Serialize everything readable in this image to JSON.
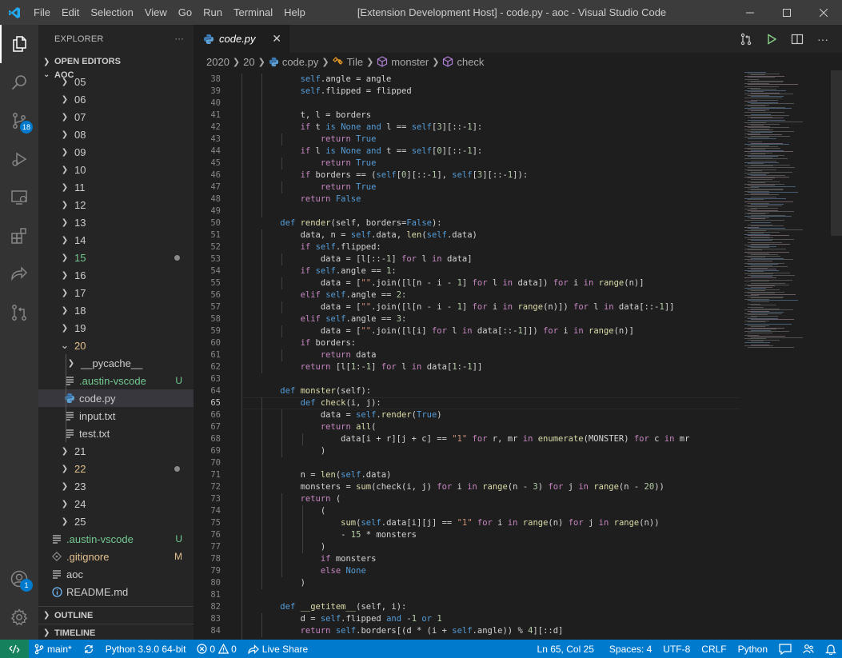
{
  "menu": [
    "File",
    "Edit",
    "Selection",
    "View",
    "Go",
    "Run",
    "Terminal",
    "Help"
  ],
  "window_title": "[Extension Development Host] - code.py - aoc - Visual Studio Code",
  "activity": {
    "scm_badge": "18",
    "accounts_badge": "1"
  },
  "sidebar": {
    "title": "EXPLORER",
    "more": "···",
    "open_editors": "OPEN EDITORS",
    "root": "AOC",
    "outline": "OUTLINE",
    "timeline": "TIMELINE"
  },
  "tree": [
    {
      "label": "05",
      "kind": "folder",
      "depth": 1,
      "open": false
    },
    {
      "label": "06",
      "kind": "folder",
      "depth": 1,
      "open": false
    },
    {
      "label": "07",
      "kind": "folder",
      "depth": 1,
      "open": false
    },
    {
      "label": "08",
      "kind": "folder",
      "depth": 1,
      "open": false
    },
    {
      "label": "09",
      "kind": "folder",
      "depth": 1,
      "open": false
    },
    {
      "label": "10",
      "kind": "folder",
      "depth": 1,
      "open": false
    },
    {
      "label": "11",
      "kind": "folder",
      "depth": 1,
      "open": false
    },
    {
      "label": "12",
      "kind": "folder",
      "depth": 1,
      "open": false
    },
    {
      "label": "13",
      "kind": "folder",
      "depth": 1,
      "open": false
    },
    {
      "label": "14",
      "kind": "folder",
      "depth": 1,
      "open": false
    },
    {
      "label": "15",
      "kind": "folder",
      "depth": 1,
      "open": false,
      "color": "green",
      "dot": true
    },
    {
      "label": "16",
      "kind": "folder",
      "depth": 1,
      "open": false
    },
    {
      "label": "17",
      "kind": "folder",
      "depth": 1,
      "open": false
    },
    {
      "label": "18",
      "kind": "folder",
      "depth": 1,
      "open": false
    },
    {
      "label": "19",
      "kind": "folder",
      "depth": 1,
      "open": false
    },
    {
      "label": "20",
      "kind": "folder",
      "depth": 1,
      "open": true,
      "color": "gold"
    },
    {
      "label": "__pycache__",
      "kind": "folder",
      "depth": 2,
      "open": false
    },
    {
      "label": ".austin-vscode",
      "kind": "file",
      "depth": 2,
      "color": "green",
      "deco": "U",
      "icon": "lines"
    },
    {
      "label": "code.py",
      "kind": "file",
      "depth": 2,
      "selected": true,
      "icon": "python"
    },
    {
      "label": "input.txt",
      "kind": "file",
      "depth": 2,
      "icon": "lines"
    },
    {
      "label": "test.txt",
      "kind": "file",
      "depth": 2,
      "icon": "lines"
    },
    {
      "label": "21",
      "kind": "folder",
      "depth": 1,
      "open": false
    },
    {
      "label": "22",
      "kind": "folder",
      "depth": 1,
      "open": false,
      "color": "gold",
      "dot": true
    },
    {
      "label": "23",
      "kind": "folder",
      "depth": 1,
      "open": false
    },
    {
      "label": "24",
      "kind": "folder",
      "depth": 1,
      "open": false
    },
    {
      "label": "25",
      "kind": "folder",
      "depth": 1,
      "open": false
    },
    {
      "label": ".austin-vscode",
      "kind": "file",
      "depth": 1,
      "color": "green",
      "deco": "U",
      "icon": "lines"
    },
    {
      "label": ".gitignore",
      "kind": "file",
      "depth": 1,
      "color": "gold",
      "deco": "M",
      "icon": "git"
    },
    {
      "label": "aoc",
      "kind": "file",
      "depth": 1,
      "icon": "lines"
    },
    {
      "label": "README.md",
      "kind": "file",
      "depth": 1,
      "icon": "info"
    }
  ],
  "tab": {
    "label": "code.py",
    "close": "✕"
  },
  "breadcrumbs": [
    "2020",
    "20",
    "code.py",
    "Tile",
    "monster",
    "check"
  ],
  "editor": {
    "first_line": 38,
    "current_line": 65
  },
  "code_lines": [
    [
      [
        "        ",
        ""
      ],
      [
        "self",
        "k"
      ],
      [
        ".angle = angle",
        ""
      ]
    ],
    [
      [
        "        ",
        ""
      ],
      [
        "self",
        "k"
      ],
      [
        ".flipped = flipped",
        ""
      ]
    ],
    [
      [
        "",
        ""
      ]
    ],
    [
      [
        "        t, l = borders",
        ""
      ]
    ],
    [
      [
        "        ",
        ""
      ],
      [
        "if",
        "c"
      ],
      [
        " t ",
        ""
      ],
      [
        "is",
        "k"
      ],
      [
        " ",
        ""
      ],
      [
        "None",
        "k"
      ],
      [
        " ",
        ""
      ],
      [
        "and",
        "k"
      ],
      [
        " l == ",
        ""
      ],
      [
        "self",
        "k"
      ],
      [
        "[",
        ""
      ],
      [
        "3",
        "n"
      ],
      [
        "][::-",
        ""
      ],
      [
        "1",
        "n"
      ],
      [
        "]:",
        ""
      ]
    ],
    [
      [
        "            ",
        ""
      ],
      [
        "return",
        "c"
      ],
      [
        " ",
        ""
      ],
      [
        "True",
        "k"
      ]
    ],
    [
      [
        "        ",
        ""
      ],
      [
        "if",
        "c"
      ],
      [
        " l ",
        ""
      ],
      [
        "is",
        "k"
      ],
      [
        " ",
        ""
      ],
      [
        "None",
        "k"
      ],
      [
        " ",
        ""
      ],
      [
        "and",
        "k"
      ],
      [
        " t == ",
        ""
      ],
      [
        "self",
        "k"
      ],
      [
        "[",
        ""
      ],
      [
        "0",
        "n"
      ],
      [
        "][::-",
        ""
      ],
      [
        "1",
        "n"
      ],
      [
        "]:",
        ""
      ]
    ],
    [
      [
        "            ",
        ""
      ],
      [
        "return",
        "c"
      ],
      [
        " ",
        ""
      ],
      [
        "True",
        "k"
      ]
    ],
    [
      [
        "        ",
        ""
      ],
      [
        "if",
        "c"
      ],
      [
        " borders == (",
        ""
      ],
      [
        "self",
        "k"
      ],
      [
        "[",
        ""
      ],
      [
        "0",
        "n"
      ],
      [
        "][::-",
        ""
      ],
      [
        "1",
        "n"
      ],
      [
        "], ",
        ""
      ],
      [
        "self",
        "k"
      ],
      [
        "[",
        ""
      ],
      [
        "3",
        "n"
      ],
      [
        "][::-",
        ""
      ],
      [
        "1",
        "n"
      ],
      [
        "]):",
        ""
      ]
    ],
    [
      [
        "            ",
        ""
      ],
      [
        "return",
        "c"
      ],
      [
        " ",
        ""
      ],
      [
        "True",
        "k"
      ]
    ],
    [
      [
        "        ",
        ""
      ],
      [
        "return",
        "c"
      ],
      [
        " ",
        ""
      ],
      [
        "False",
        "k"
      ]
    ],
    [
      [
        "",
        ""
      ]
    ],
    [
      [
        "    ",
        ""
      ],
      [
        "def",
        "k"
      ],
      [
        " ",
        ""
      ],
      [
        "render",
        "f"
      ],
      [
        "(self, borders=",
        ""
      ],
      [
        "False",
        "k"
      ],
      [
        "):",
        ""
      ]
    ],
    [
      [
        "        data, n = ",
        ""
      ],
      [
        "self",
        "k"
      ],
      [
        ".data, ",
        ""
      ],
      [
        "len",
        "f"
      ],
      [
        "(",
        ""
      ],
      [
        "self",
        "k"
      ],
      [
        ".data)",
        ""
      ]
    ],
    [
      [
        "        ",
        ""
      ],
      [
        "if",
        "c"
      ],
      [
        " ",
        ""
      ],
      [
        "self",
        "k"
      ],
      [
        ".flipped:",
        ""
      ]
    ],
    [
      [
        "            data = [l[::-",
        ""
      ],
      [
        "1",
        "n"
      ],
      [
        "] ",
        ""
      ],
      [
        "for",
        "c"
      ],
      [
        " l ",
        ""
      ],
      [
        "in",
        "c"
      ],
      [
        " data]",
        ""
      ]
    ],
    [
      [
        "        ",
        ""
      ],
      [
        "if",
        "c"
      ],
      [
        " ",
        ""
      ],
      [
        "self",
        "k"
      ],
      [
        ".angle == ",
        ""
      ],
      [
        "1",
        "n"
      ],
      [
        ":",
        ""
      ]
    ],
    [
      [
        "            data = [",
        ""
      ],
      [
        "\"\"",
        "s"
      ],
      [
        ".join([l[n - i - ",
        ""
      ],
      [
        "1",
        "n"
      ],
      [
        "] ",
        ""
      ],
      [
        "for",
        "c"
      ],
      [
        " l ",
        ""
      ],
      [
        "in",
        "c"
      ],
      [
        " data]) ",
        ""
      ],
      [
        "for",
        "c"
      ],
      [
        " i ",
        ""
      ],
      [
        "in",
        "c"
      ],
      [
        " ",
        ""
      ],
      [
        "range",
        "f"
      ],
      [
        "(n)]",
        ""
      ]
    ],
    [
      [
        "        ",
        ""
      ],
      [
        "elif",
        "c"
      ],
      [
        " ",
        ""
      ],
      [
        "self",
        "k"
      ],
      [
        ".angle == ",
        ""
      ],
      [
        "2",
        "n"
      ],
      [
        ":",
        ""
      ]
    ],
    [
      [
        "            data = [",
        ""
      ],
      [
        "\"\"",
        "s"
      ],
      [
        ".join([l[n - i - ",
        ""
      ],
      [
        "1",
        "n"
      ],
      [
        "] ",
        ""
      ],
      [
        "for",
        "c"
      ],
      [
        " i ",
        ""
      ],
      [
        "in",
        "c"
      ],
      [
        " ",
        ""
      ],
      [
        "range",
        "f"
      ],
      [
        "(n)]) ",
        ""
      ],
      [
        "for",
        "c"
      ],
      [
        " l ",
        ""
      ],
      [
        "in",
        "c"
      ],
      [
        " data[::-",
        ""
      ],
      [
        "1",
        "n"
      ],
      [
        "]]",
        ""
      ]
    ],
    [
      [
        "        ",
        ""
      ],
      [
        "elif",
        "c"
      ],
      [
        " ",
        ""
      ],
      [
        "self",
        "k"
      ],
      [
        ".angle == ",
        ""
      ],
      [
        "3",
        "n"
      ],
      [
        ":",
        ""
      ]
    ],
    [
      [
        "            data = [",
        ""
      ],
      [
        "\"\"",
        "s"
      ],
      [
        ".join([l[i] ",
        ""
      ],
      [
        "for",
        "c"
      ],
      [
        " l ",
        ""
      ],
      [
        "in",
        "c"
      ],
      [
        " data[::-",
        ""
      ],
      [
        "1",
        "n"
      ],
      [
        "]]) ",
        ""
      ],
      [
        "for",
        "c"
      ],
      [
        " i ",
        ""
      ],
      [
        "in",
        "c"
      ],
      [
        " ",
        ""
      ],
      [
        "range",
        "f"
      ],
      [
        "(n)]",
        ""
      ]
    ],
    [
      [
        "        ",
        ""
      ],
      [
        "if",
        "c"
      ],
      [
        " borders:",
        ""
      ]
    ],
    [
      [
        "            ",
        ""
      ],
      [
        "return",
        "c"
      ],
      [
        " data",
        ""
      ]
    ],
    [
      [
        "        ",
        ""
      ],
      [
        "return",
        "c"
      ],
      [
        " [l[",
        ""
      ],
      [
        "1",
        "n"
      ],
      [
        ":-",
        ""
      ],
      [
        "1",
        "n"
      ],
      [
        "] ",
        ""
      ],
      [
        "for",
        "c"
      ],
      [
        " l ",
        ""
      ],
      [
        "in",
        "c"
      ],
      [
        " data[",
        ""
      ],
      [
        "1",
        "n"
      ],
      [
        ":-",
        ""
      ],
      [
        "1",
        "n"
      ],
      [
        "]]",
        ""
      ]
    ],
    [
      [
        "",
        ""
      ]
    ],
    [
      [
        "    ",
        ""
      ],
      [
        "def",
        "k"
      ],
      [
        " ",
        ""
      ],
      [
        "monster",
        "f"
      ],
      [
        "(self):",
        ""
      ]
    ],
    [
      [
        "        ",
        ""
      ],
      [
        "def",
        "k"
      ],
      [
        " ",
        ""
      ],
      [
        "check",
        "f"
      ],
      [
        "(i, j):",
        ""
      ]
    ],
    [
      [
        "            data = ",
        ""
      ],
      [
        "self",
        "k"
      ],
      [
        ".",
        ""
      ],
      [
        "render",
        "f"
      ],
      [
        "(",
        ""
      ],
      [
        "True",
        "k"
      ],
      [
        ")",
        ""
      ]
    ],
    [
      [
        "            ",
        ""
      ],
      [
        "return",
        "c"
      ],
      [
        " ",
        ""
      ],
      [
        "all",
        "f"
      ],
      [
        "(",
        ""
      ]
    ],
    [
      [
        "                data[i + r][j + c] == ",
        ""
      ],
      [
        "\"1\"",
        "s"
      ],
      [
        " ",
        ""
      ],
      [
        "for",
        "c"
      ],
      [
        " r, mr ",
        ""
      ],
      [
        "in",
        "c"
      ],
      [
        " ",
        ""
      ],
      [
        "enumerate",
        "f"
      ],
      [
        "(MONSTER) ",
        ""
      ],
      [
        "for",
        "c"
      ],
      [
        " c ",
        ""
      ],
      [
        "in",
        "c"
      ],
      [
        " mr",
        ""
      ]
    ],
    [
      [
        "            )",
        ""
      ]
    ],
    [
      [
        "",
        ""
      ]
    ],
    [
      [
        "        n = ",
        ""
      ],
      [
        "len",
        "f"
      ],
      [
        "(",
        ""
      ],
      [
        "self",
        "k"
      ],
      [
        ".data)",
        ""
      ]
    ],
    [
      [
        "        monsters = ",
        ""
      ],
      [
        "sum",
        "f"
      ],
      [
        "(check(i, j) ",
        ""
      ],
      [
        "for",
        "c"
      ],
      [
        " i ",
        ""
      ],
      [
        "in",
        "c"
      ],
      [
        " ",
        ""
      ],
      [
        "range",
        "f"
      ],
      [
        "(n - ",
        ""
      ],
      [
        "3",
        "n"
      ],
      [
        ") ",
        ""
      ],
      [
        "for",
        "c"
      ],
      [
        " j ",
        ""
      ],
      [
        "in",
        "c"
      ],
      [
        " ",
        ""
      ],
      [
        "range",
        "f"
      ],
      [
        "(n - ",
        ""
      ],
      [
        "20",
        "n"
      ],
      [
        "))",
        ""
      ]
    ],
    [
      [
        "        ",
        ""
      ],
      [
        "return",
        "c"
      ],
      [
        " (",
        ""
      ]
    ],
    [
      [
        "            (",
        ""
      ]
    ],
    [
      [
        "                ",
        ""
      ],
      [
        "sum",
        "f"
      ],
      [
        "(",
        ""
      ],
      [
        "self",
        "k"
      ],
      [
        ".data[i][j] == ",
        ""
      ],
      [
        "\"1\"",
        "s"
      ],
      [
        " ",
        ""
      ],
      [
        "for",
        "c"
      ],
      [
        " i ",
        ""
      ],
      [
        "in",
        "c"
      ],
      [
        " ",
        ""
      ],
      [
        "range",
        "f"
      ],
      [
        "(n) ",
        ""
      ],
      [
        "for",
        "c"
      ],
      [
        " j ",
        ""
      ],
      [
        "in",
        "c"
      ],
      [
        " ",
        ""
      ],
      [
        "range",
        "f"
      ],
      [
        "(n))",
        ""
      ]
    ],
    [
      [
        "                - ",
        ""
      ],
      [
        "15",
        "n"
      ],
      [
        " * monsters",
        ""
      ]
    ],
    [
      [
        "            )",
        ""
      ]
    ],
    [
      [
        "            ",
        ""
      ],
      [
        "if",
        "c"
      ],
      [
        " monsters",
        ""
      ]
    ],
    [
      [
        "            ",
        ""
      ],
      [
        "else",
        "c"
      ],
      [
        " ",
        ""
      ],
      [
        "None",
        "k"
      ]
    ],
    [
      [
        "        )",
        ""
      ]
    ],
    [
      [
        "",
        ""
      ]
    ],
    [
      [
        "    ",
        ""
      ],
      [
        "def",
        "k"
      ],
      [
        " ",
        ""
      ],
      [
        "__getitem__",
        "f"
      ],
      [
        "(self, i):",
        ""
      ]
    ],
    [
      [
        "        d = ",
        ""
      ],
      [
        "self",
        "k"
      ],
      [
        ".flipped ",
        ""
      ],
      [
        "and",
        "k"
      ],
      [
        " -",
        ""
      ],
      [
        "1",
        "n"
      ],
      [
        " ",
        ""
      ],
      [
        "or",
        "k"
      ],
      [
        " ",
        ""
      ],
      [
        "1",
        "n"
      ]
    ],
    [
      [
        "        ",
        ""
      ],
      [
        "return",
        "c"
      ],
      [
        " ",
        ""
      ],
      [
        "self",
        "k"
      ],
      [
        ".borders[(d * (i + ",
        ""
      ],
      [
        "self",
        "k"
      ],
      [
        ".angle)) % ",
        ""
      ],
      [
        "4",
        "n"
      ],
      [
        "][::d]",
        ""
      ]
    ]
  ],
  "status": {
    "branch": "main*",
    "python": "Python 3.9.0 64-bit",
    "errors": "0",
    "warnings": "0",
    "live_share": "Live Share",
    "position": "Ln 65, Col 25",
    "spaces": "Spaces: 4",
    "encoding": "UTF-8",
    "eol": "CRLF",
    "language": "Python"
  },
  "colors": {
    "accent": "#007acc",
    "remote": "#16825d",
    "untracked": "#73c991",
    "modified": "#e2c08d"
  }
}
